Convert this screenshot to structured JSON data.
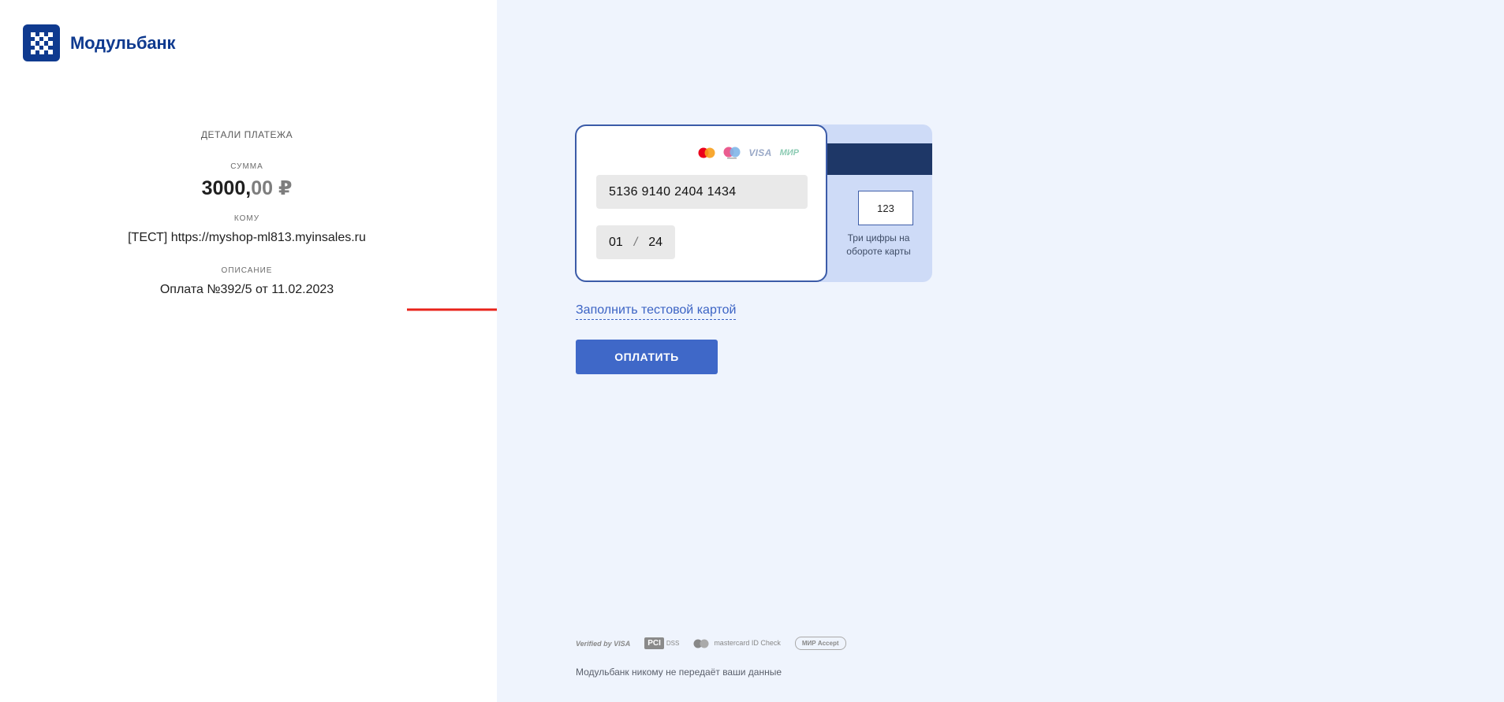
{
  "brand": {
    "name": "Модульбанк"
  },
  "payment": {
    "section_title": "ДЕТАЛИ ПЛАТЕЖА",
    "sum_label": "СУММА",
    "amount_whole": "3000,",
    "amount_cents": "00",
    "currency": "₽",
    "to_label": "КОМУ",
    "to_value": "[ТЕСТ] https://myshop-ml813.myinsales.ru",
    "description_label": "ОПИСАНИЕ",
    "description_value": "Оплата №392/5 от 11.02.2023"
  },
  "card": {
    "brand_icons": [
      "mastercard-icon",
      "maestro-icon",
      "visa-icon",
      "mir-icon"
    ],
    "visa_text": "VISA",
    "mir_text": "МИР",
    "number": "5136 9140 2404 1434",
    "exp_month": "01",
    "exp_separator": "/",
    "exp_year": "24",
    "cvv": "123",
    "cvv_hint": "Три цифры на обороте карты"
  },
  "actions": {
    "fill_test_card": "Заполнить тестовой картой",
    "pay": "ОПЛАТИТЬ"
  },
  "security": {
    "verified_by_visa": "Verified by VISA",
    "pci": "PCI",
    "dss": "DSS",
    "mastercard_id_check": "mastercard ID Check",
    "mir_accept": "МИР Accept",
    "note": "Модульбанк никому не передаёт ваши данные"
  },
  "colors": {
    "brand": "#0f3a8f",
    "accent": "#3f68c8",
    "right_bg": "#eff4fd",
    "arrow": "#e8231b"
  }
}
